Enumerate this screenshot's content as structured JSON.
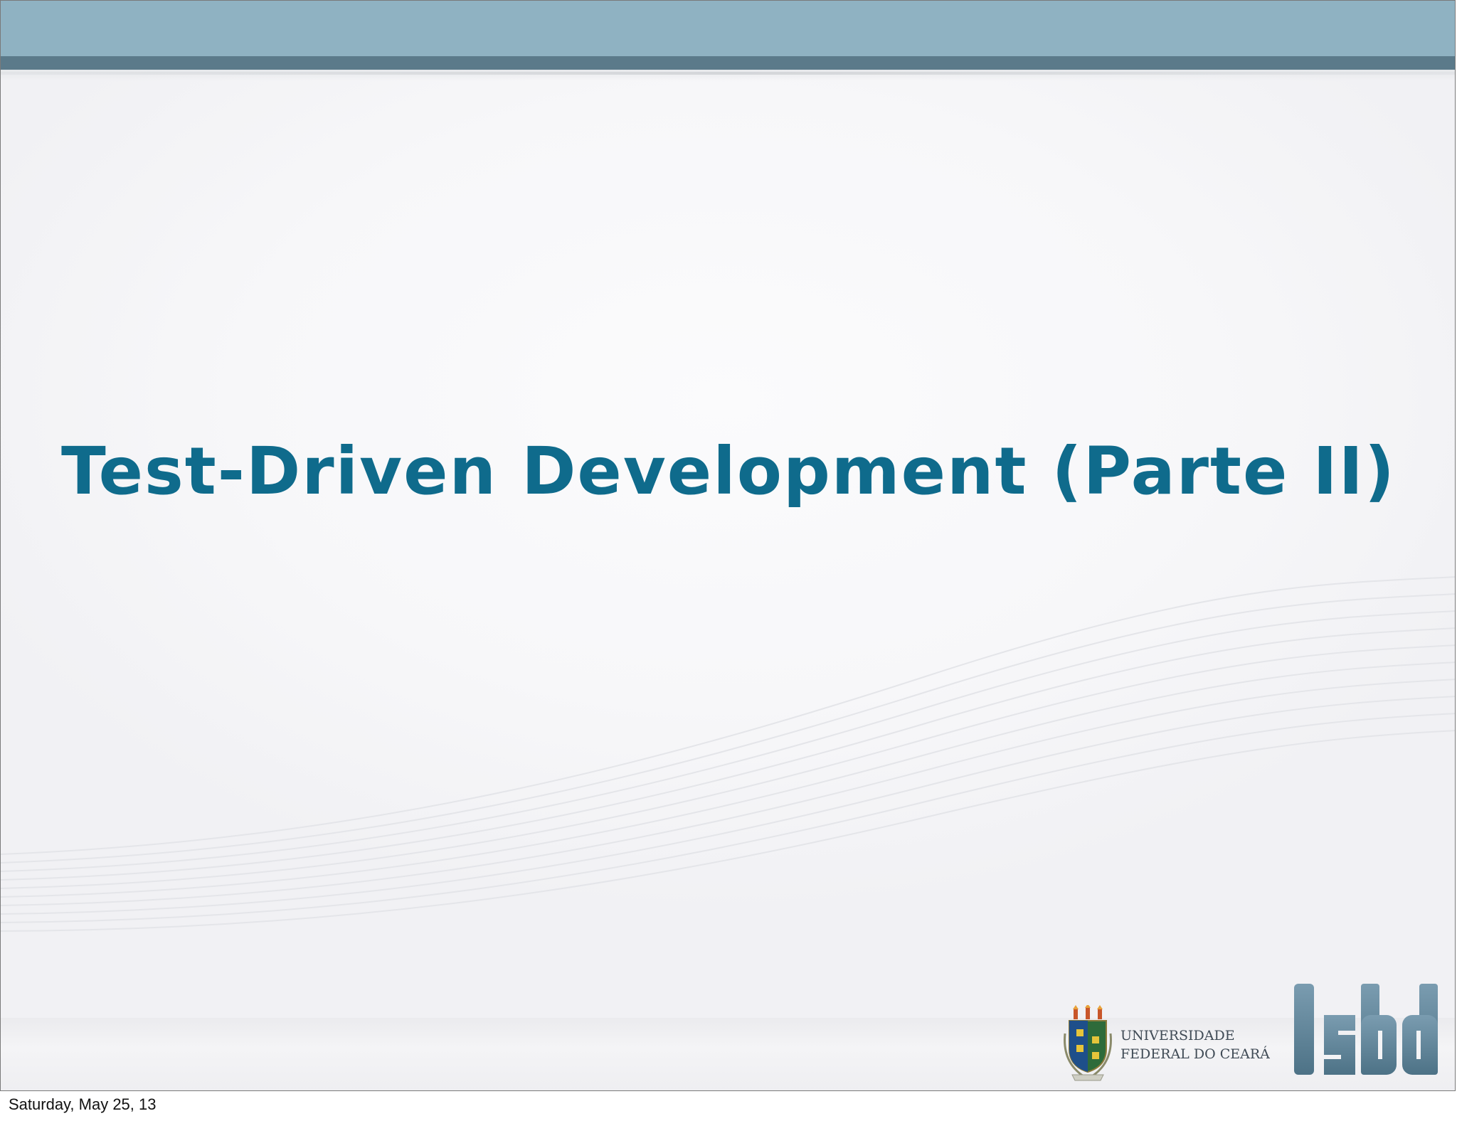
{
  "slide": {
    "title": "Test-Driven Development (Parte II)",
    "title_color": "#0f6b8c",
    "header_band_color": "#8fb2c2",
    "header_band_dark_color": "#5b7a8a"
  },
  "logos": {
    "university_line1": "UNIVERSIDADE",
    "university_line2": "FEDERAL DO CEARÁ",
    "lab_logo": "lsbd",
    "lab_logo_color": "#5a7f93"
  },
  "footer": {
    "date": "Saturday, May 25, 13"
  }
}
